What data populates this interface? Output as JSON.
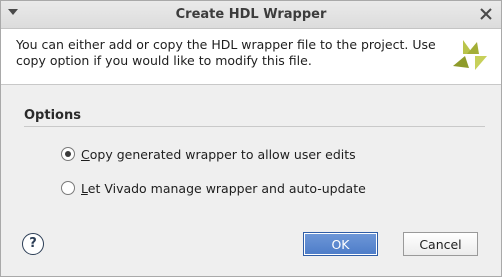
{
  "window": {
    "title": "Create HDL Wrapper"
  },
  "header": {
    "description": "You can either add or copy the HDL wrapper file to the project. Use copy option if you would like to modify this file.",
    "logo_icon": "xilinx-logo"
  },
  "options": {
    "title": "Options",
    "items": [
      {
        "mnemonic": "C",
        "rest": "opy generated wrapper to allow user edits",
        "selected": true
      },
      {
        "mnemonic": "L",
        "rest": "et Vivado manage wrapper and auto-update",
        "selected": false
      }
    ]
  },
  "footer": {
    "help_label": "?",
    "ok_label": "OK",
    "cancel_label": "Cancel"
  },
  "colors": {
    "accent": "#4d7cc8",
    "logo": "#a8b53a"
  }
}
